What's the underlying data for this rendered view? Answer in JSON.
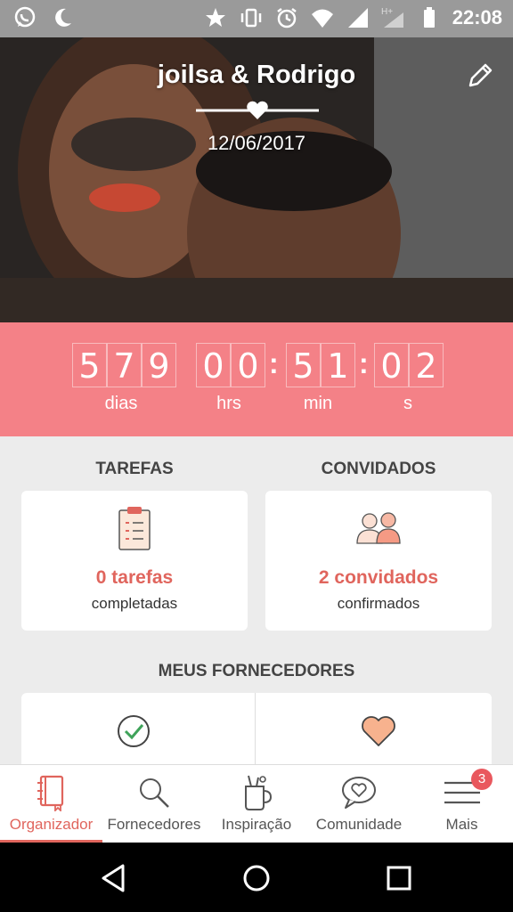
{
  "status_bar": {
    "time": "22:08",
    "left_icons": [
      "whatsapp-icon",
      "moon-icon"
    ],
    "right_icons": [
      "star-icon",
      "vibrate-icon",
      "alarm-icon",
      "wifi-icon",
      "signal-icon",
      "hplus-signal-icon",
      "battery-icon"
    ]
  },
  "hero": {
    "couple_names": "joilsa & Rodrigo",
    "date": "12/06/2017",
    "edit_icon": "pencil-icon"
  },
  "countdown": {
    "days": [
      "5",
      "7",
      "9"
    ],
    "hours": [
      "0",
      "0"
    ],
    "minutes": [
      "5",
      "1"
    ],
    "seconds": [
      "0",
      "2"
    ],
    "labels": {
      "days": "dias",
      "hours": "hrs",
      "minutes": "min",
      "seconds": "s"
    }
  },
  "tarefas": {
    "title": "TAREFAS",
    "count": "0 tarefas",
    "sub": "completadas",
    "icon": "clipboard-icon"
  },
  "convidados": {
    "title": "CONVIDADOS",
    "count": "2 convidados",
    "sub": "confirmados",
    "icon": "guests-icon"
  },
  "fornecedores": {
    "title": "MEUS FORNECEDORES",
    "icons": [
      "check-circle-icon",
      "heart-icon"
    ]
  },
  "tabbar": {
    "tabs": [
      {
        "label": "Organizador",
        "icon": "notebook-icon",
        "active": true
      },
      {
        "label": "Fornecedores",
        "icon": "search-icon"
      },
      {
        "label": "Inspiração",
        "icon": "cup-icon"
      },
      {
        "label": "Comunidade",
        "icon": "chat-heart-icon"
      },
      {
        "label": "Mais",
        "icon": "menu-icon",
        "badge": "3"
      }
    ]
  },
  "colors": {
    "accent": "#e0655d",
    "countdown_bg": "#f48187",
    "status_bar": "#9a9a9a"
  }
}
